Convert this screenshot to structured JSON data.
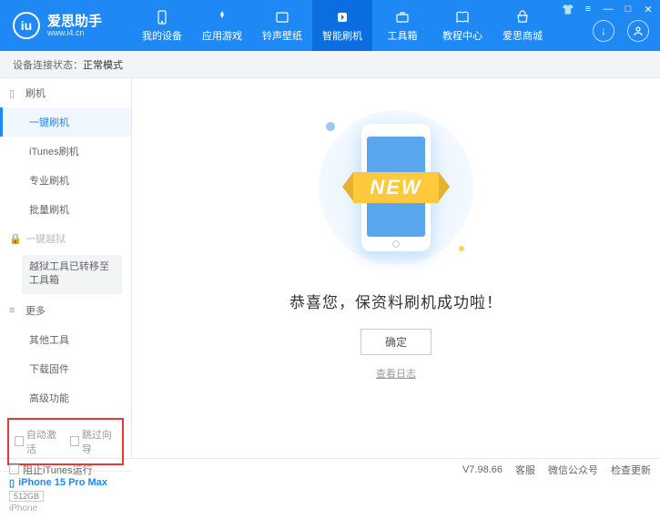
{
  "header": {
    "logo_badge": "iu",
    "logo_title": "爱思助手",
    "logo_sub": "www.i4.cn",
    "nav": [
      {
        "label": "我的设备"
      },
      {
        "label": "应用游戏"
      },
      {
        "label": "铃声壁纸"
      },
      {
        "label": "智能刷机"
      },
      {
        "label": "工具箱"
      },
      {
        "label": "教程中心"
      },
      {
        "label": "爱思商城"
      }
    ]
  },
  "status": {
    "label": "设备连接状态：",
    "value": "正常模式"
  },
  "sidebar": {
    "section_flash": "刷机",
    "items_flash": [
      "一键刷机",
      "iTunes刷机",
      "专业刷机",
      "批量刷机"
    ],
    "section_jailbreak": "一键越狱",
    "jailbreak_note": "越狱工具已转移至工具箱",
    "section_more": "更多",
    "items_more": [
      "其他工具",
      "下载固件",
      "高级功能"
    ],
    "checkbox1": "自动激活",
    "checkbox2": "跳过向导",
    "device_name": "iPhone 15 Pro Max",
    "device_storage": "512GB",
    "device_model": "iPhone"
  },
  "main": {
    "banner": "NEW",
    "success": "恭喜您，保资料刷机成功啦！",
    "ok": "确定",
    "log": "查看日志"
  },
  "footer": {
    "block_itunes": "阻止iTunes运行",
    "version": "V7.98.66",
    "links": [
      "客服",
      "微信公众号",
      "检查更新"
    ]
  }
}
